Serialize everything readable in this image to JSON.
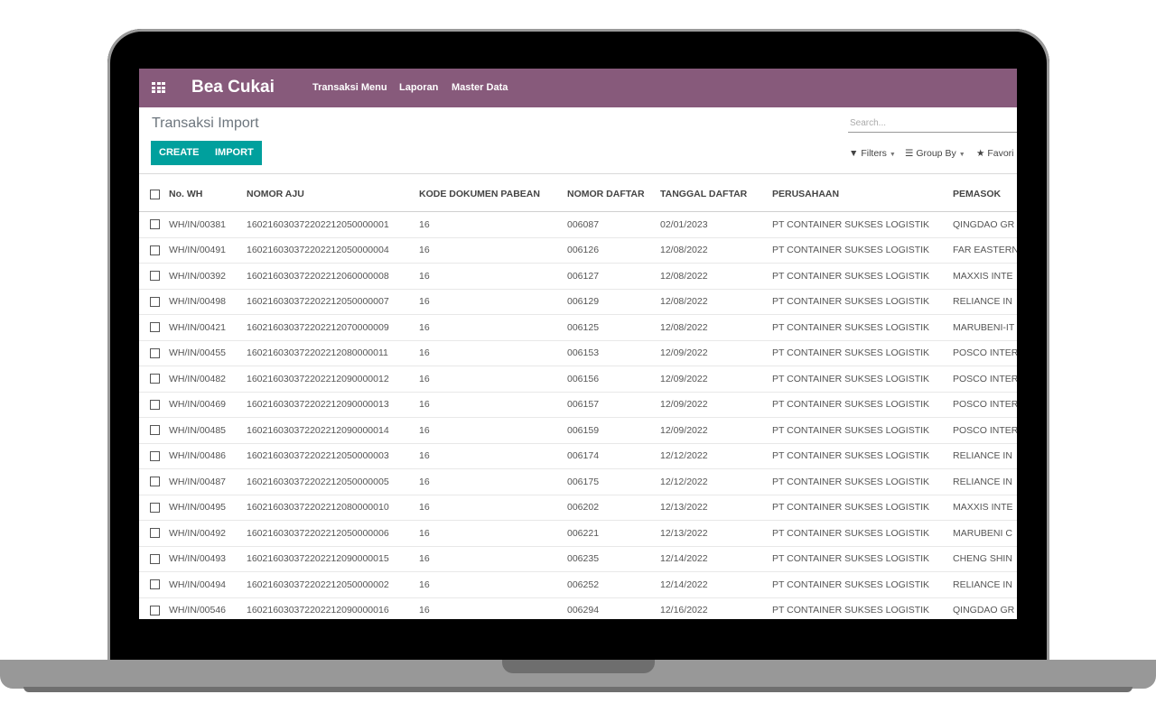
{
  "app": {
    "brand": "Bea Cukai",
    "menu": [
      "Transaksi Menu",
      "Laporan",
      "Master Data"
    ]
  },
  "page": {
    "title": "Transaksi Import",
    "create_label": "CREATE",
    "import_label": "IMPORT",
    "search_placeholder": "Search...",
    "filters_label": "Filters",
    "group_by_label": "Group By",
    "favorites_label": "Favori"
  },
  "colors": {
    "navbar": "#875a7b",
    "button": "#00a09d"
  },
  "table": {
    "columns": [
      "No. WH",
      "NOMOR AJU",
      "KODE DOKUMEN PABEAN",
      "NOMOR DAFTAR",
      "TANGGAL DAFTAR",
      "PERUSAHAAN",
      "PEMASOK"
    ],
    "rows": [
      [
        "WH/IN/00381",
        "160216030372202212050000001",
        "16",
        "006087",
        "02/01/2023",
        "PT CONTAINER SUKSES LOGISTIK",
        "QINGDAO GR"
      ],
      [
        "WH/IN/00491",
        "160216030372202212050000004",
        "16",
        "006126",
        "12/08/2022",
        "PT CONTAINER SUKSES LOGISTIK",
        "FAR EASTERN"
      ],
      [
        "WH/IN/00392",
        "160216030372202212060000008",
        "16",
        "006127",
        "12/08/2022",
        "PT CONTAINER SUKSES LOGISTIK",
        "MAXXIS INTE"
      ],
      [
        "WH/IN/00498",
        "160216030372202212050000007",
        "16",
        "006129",
        "12/08/2022",
        "PT CONTAINER SUKSES LOGISTIK",
        "RELIANCE IN"
      ],
      [
        "WH/IN/00421",
        "160216030372202212070000009",
        "16",
        "006125",
        "12/08/2022",
        "PT CONTAINER SUKSES LOGISTIK",
        "MARUBENI-IT"
      ],
      [
        "WH/IN/00455",
        "160216030372202212080000011",
        "16",
        "006153",
        "12/09/2022",
        "PT CONTAINER SUKSES LOGISTIK",
        "POSCO INTER"
      ],
      [
        "WH/IN/00482",
        "160216030372202212090000012",
        "16",
        "006156",
        "12/09/2022",
        "PT CONTAINER SUKSES LOGISTIK",
        "POSCO INTER"
      ],
      [
        "WH/IN/00469",
        "160216030372202212090000013",
        "16",
        "006157",
        "12/09/2022",
        "PT CONTAINER SUKSES LOGISTIK",
        "POSCO INTER"
      ],
      [
        "WH/IN/00485",
        "160216030372202212090000014",
        "16",
        "006159",
        "12/09/2022",
        "PT CONTAINER SUKSES LOGISTIK",
        "POSCO INTER"
      ],
      [
        "WH/IN/00486",
        "160216030372202212050000003",
        "16",
        "006174",
        "12/12/2022",
        "PT CONTAINER SUKSES LOGISTIK",
        "RELIANCE IN"
      ],
      [
        "WH/IN/00487",
        "160216030372202212050000005",
        "16",
        "006175",
        "12/12/2022",
        "PT CONTAINER SUKSES LOGISTIK",
        "RELIANCE IN"
      ],
      [
        "WH/IN/00495",
        "160216030372202212080000010",
        "16",
        "006202",
        "12/13/2022",
        "PT CONTAINER SUKSES LOGISTIK",
        "MAXXIS INTE"
      ],
      [
        "WH/IN/00492",
        "160216030372202212050000006",
        "16",
        "006221",
        "12/13/2022",
        "PT CONTAINER SUKSES LOGISTIK",
        "MARUBENI C"
      ],
      [
        "WH/IN/00493",
        "160216030372202212090000015",
        "16",
        "006235",
        "12/14/2022",
        "PT CONTAINER SUKSES LOGISTIK",
        "CHENG SHIN"
      ],
      [
        "WH/IN/00494",
        "160216030372202212050000002",
        "16",
        "006252",
        "12/14/2022",
        "PT CONTAINER SUKSES LOGISTIK",
        "RELIANCE IN"
      ],
      [
        "WH/IN/00546",
        "160216030372202212090000016",
        "16",
        "006294",
        "12/16/2022",
        "PT CONTAINER SUKSES LOGISTIK",
        "QINGDAO GR"
      ]
    ]
  }
}
